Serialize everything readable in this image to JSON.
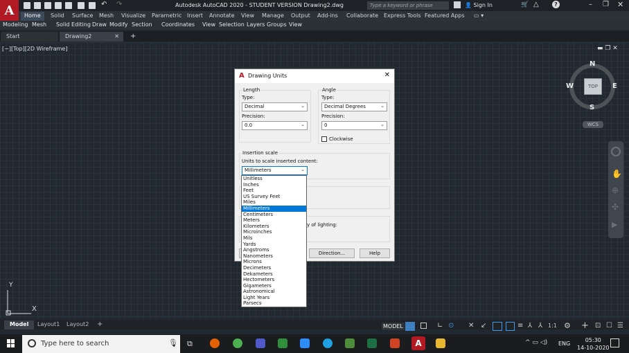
{
  "app": {
    "title": "Autodesk AutoCAD 2020 - STUDENT VERSION    Drawing2.dwg",
    "search_placeholder": "Type a keyword or phrase",
    "sign_in": "Sign In"
  },
  "ribbon_tabs": [
    "Home",
    "Solid",
    "Surface",
    "Mesh",
    "Visualize",
    "Parametric",
    "Insert",
    "Annotate",
    "View",
    "Manage",
    "Output",
    "Add-ins",
    "Collaborate",
    "Express Tools",
    "Featured Apps"
  ],
  "menu_items": [
    "Modeling",
    "Mesh",
    "Solid Editing",
    "Draw",
    "Modify",
    "Section",
    "Coordinates",
    "View",
    "Selection",
    "Layers",
    "Groups",
    "View"
  ],
  "file_tabs": [
    "Start",
    "Drawing2"
  ],
  "viewport": {
    "label": "[−][Top][2D Wireframe]",
    "compass": {
      "n": "N",
      "s": "S",
      "e": "E",
      "w": "W",
      "top": "TOP"
    },
    "wcs": "WCS",
    "ucs_y": "Y",
    "ucs_x": "X"
  },
  "layout_tabs": [
    "Model",
    "Layout1",
    "Layout2"
  ],
  "status": {
    "model": "MODEL",
    "scale": "1:1"
  },
  "taskbar": {
    "search": "Type here to search",
    "lang": "ENG",
    "time": "05:30",
    "date": "14-10-2020"
  },
  "dialog": {
    "title": "Drawing Units",
    "length": {
      "group": "Length",
      "type_label": "Type:",
      "type_value": "Decimal",
      "precision_label": "Precision:",
      "precision_value": "0.0"
    },
    "angle": {
      "group": "Angle",
      "type_label": "Type:",
      "type_value": "Decimal Degrees",
      "precision_label": "Precision:",
      "precision_value": "0",
      "clockwise": "Clockwise"
    },
    "insertion": {
      "group": "Insertion scale",
      "units_label": "Units to scale inserted content:",
      "units_value": "Millimeters"
    },
    "lighting_text": "y of lighting:",
    "direction_button": "Direction...",
    "help_button": "Help",
    "unit_options": [
      "Unitless",
      "Inches",
      "Feet",
      "US Survey Feet",
      "Miles",
      "Millimeters",
      "Centimeters",
      "Meters",
      "Kilometers",
      "Microinches",
      "Mils",
      "Yards",
      "Angstroms",
      "Nanometers",
      "Microns",
      "Decimeters",
      "Dekameters",
      "Hectometers",
      "Gigameters",
      "Astronomical",
      "Light Years",
      "Parsecs"
    ],
    "selected_option": "Millimeters"
  }
}
